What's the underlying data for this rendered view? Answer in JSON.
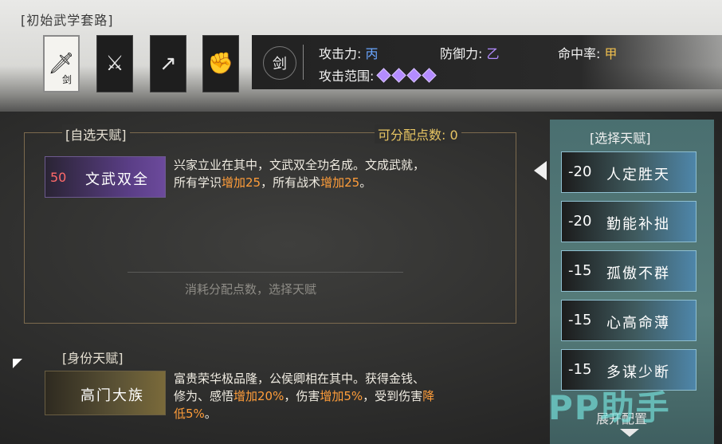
{
  "header": {
    "route_title": "[初始武学套路]"
  },
  "weapons": [
    {
      "icon": "sword-icon",
      "sub_label": "剑",
      "active": true
    },
    {
      "icon": "blade-icon",
      "active": false
    },
    {
      "icon": "spear-icon",
      "active": false
    },
    {
      "icon": "fist-icon",
      "active": false
    }
  ],
  "stats": {
    "type": "剑",
    "attack_label": "攻击力:",
    "attack_grade": "丙",
    "defense_label": "防御力:",
    "defense_grade": "乙",
    "hit_label": "命中率:",
    "hit_grade": "甲",
    "range_label": "攻击范围:",
    "range_level": 4
  },
  "custom_talent": {
    "title": "[自选天赋]",
    "points_label": "可分配点数: 0",
    "selected": {
      "cost": "50",
      "name": "文武双全",
      "desc_line1": "兴家立业在其中，文武双全功名成。文成武就，",
      "desc_line2_a": "所有学识",
      "desc_line2_b": "增加25",
      "desc_line2_c": "，所有战术",
      "desc_line2_d": "增加25",
      "desc_line2_e": "。"
    },
    "hint": "消耗分配点数，选择天赋"
  },
  "identity_talent": {
    "title": "[身份天赋]",
    "name": "高门大族",
    "desc_line1": "富贵荣华极品隆，公侯卿相在其中。获得金钱、",
    "desc_line2_a": "修为、感悟",
    "desc_line2_b": "增加20%",
    "desc_line2_c": "，伤害",
    "desc_line2_d": "增加5%",
    "desc_line2_e": "，受到伤害",
    "desc_line2_f": "降",
    "desc_line3_a": "低5%",
    "desc_line3_b": "。"
  },
  "select_panel": {
    "title": "[选择天赋]",
    "items": [
      {
        "cost": "-20",
        "name": "人定胜天"
      },
      {
        "cost": "-20",
        "name": "勤能补拙"
      },
      {
        "cost": "-15",
        "name": "孤傲不群"
      },
      {
        "cost": "-15",
        "name": "心高命薄"
      },
      {
        "cost": "-15",
        "name": "多谋少断"
      }
    ],
    "expand_label": "展开配置"
  },
  "watermark": "PP助手",
  "colors": {
    "accent_gold": "#e7c563",
    "highlight_orange": "#ff9d3a",
    "grade_blue": "#6aa6ff",
    "grade_purple": "#b38cff",
    "grade_gold": "#f2c14e"
  }
}
